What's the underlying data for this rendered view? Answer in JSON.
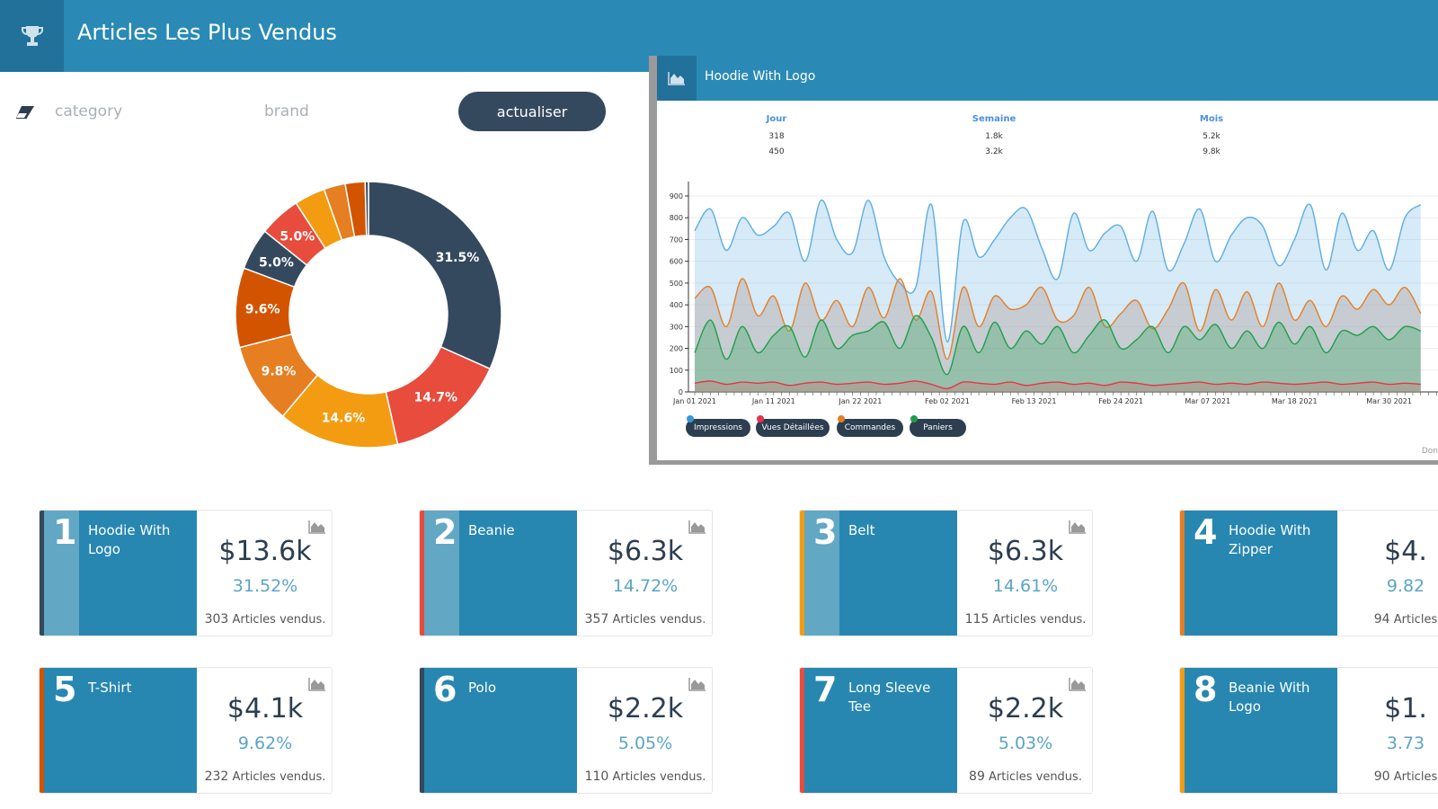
{
  "header": {
    "title": "Articles Les Plus Vendus",
    "icon": "trophy-icon"
  },
  "filters": {
    "category_placeholder": "category",
    "brand_placeholder": "brand",
    "refresh_label": "actualiser",
    "clear_icon": "eraser-icon"
  },
  "colors": {
    "header": "#2a8ab5",
    "navy": "#34495e",
    "red": "#e74c3c",
    "yellow": "#f39c12",
    "orange": "#e67e22",
    "darkorange": "#d35400"
  },
  "donut": {
    "type": "pie",
    "segments": [
      {
        "value": 31.52,
        "label": "31.5%",
        "color": "#34495e"
      },
      {
        "value": 14.72,
        "label": "14.7%",
        "color": "#e74c3c"
      },
      {
        "value": 14.61,
        "label": "14.6%",
        "color": "#f39c12"
      },
      {
        "value": 9.82,
        "label": "9.8%",
        "color": "#e67e22"
      },
      {
        "value": 9.62,
        "label": "9.6%",
        "color": "#d35400"
      },
      {
        "value": 5.05,
        "label": "5.0%",
        "color": "#34495e"
      },
      {
        "value": 5.03,
        "label": "5.0%",
        "color": "#e74c3c"
      },
      {
        "value": 3.73,
        "label": "",
        "color": "#f39c12"
      },
      {
        "value": 2.6,
        "label": "",
        "color": "#e67e22"
      },
      {
        "value": 2.4,
        "label": "",
        "color": "#d35400"
      },
      {
        "value": 0.4,
        "label": "",
        "color": "#34495e"
      }
    ]
  },
  "panel": {
    "title": "Hoodie With Logo",
    "icon": "area-chart-icon",
    "stats": [
      {
        "head": "Jour",
        "v1": "318",
        "v2": "450"
      },
      {
        "head": "Semaine",
        "v1": "1.8k",
        "v2": "3.2k"
      },
      {
        "head": "Mois",
        "v1": "5.2k",
        "v2": "9.8k"
      }
    ],
    "footer": "Don"
  },
  "chart_data": {
    "type": "area",
    "ylim": [
      0,
      900
    ],
    "yticks": [
      0,
      100,
      200,
      300,
      400,
      500,
      600,
      700,
      800,
      900
    ],
    "xticks": [
      "Jan 01 2021",
      "Jan 11 2021",
      "Jan 22 2021",
      "Feb 02 2021",
      "Feb 13 2021",
      "Feb 24 2021",
      "Mar 07 2021",
      "Mar 18 2021",
      "Mar 30 2021"
    ],
    "x_start": "2021-01-01",
    "x_step_days": 2,
    "series": [
      {
        "name": "Impressions",
        "color": "#5dade2",
        "values": [
          740,
          840,
          650,
          800,
          720,
          760,
          820,
          600,
          880,
          700,
          640,
          880,
          620,
          500,
          480,
          860,
          230,
          780,
          620,
          700,
          800,
          840,
          660,
          520,
          820,
          650,
          730,
          760,
          600,
          830,
          560,
          680,
          840,
          600,
          720,
          800,
          760,
          580,
          700,
          860,
          560,
          820,
          650,
          740,
          560,
          800,
          860
        ]
      },
      {
        "name": "Vues Détaillées",
        "color": "#e8334a",
        "values": [
          40,
          50,
          35,
          45,
          40,
          45,
          30,
          40,
          45,
          35,
          40,
          45,
          35,
          40,
          50,
          35,
          15,
          45,
          40,
          35,
          45,
          30,
          40,
          45,
          35,
          40,
          30,
          45,
          40,
          30,
          35,
          40,
          45,
          35,
          40,
          35,
          45,
          40,
          35,
          40,
          45,
          35,
          40,
          45,
          35,
          40,
          35
        ]
      },
      {
        "name": "Commandes",
        "color": "#e67e22",
        "values": [
          430,
          480,
          300,
          520,
          350,
          440,
          280,
          500,
          330,
          420,
          300,
          480,
          340,
          520,
          330,
          460,
          150,
          480,
          300,
          440,
          380,
          400,
          480,
          330,
          350,
          480,
          300,
          360,
          420,
          290,
          380,
          500,
          280,
          470,
          330,
          460,
          300,
          500,
          330,
          420,
          300,
          440,
          380,
          470,
          400,
          480,
          360
        ]
      },
      {
        "name": "Paniers",
        "color": "#1e9e4a",
        "values": [
          180,
          330,
          150,
          300,
          180,
          260,
          300,
          160,
          330,
          200,
          260,
          280,
          320,
          200,
          350,
          250,
          80,
          300,
          180,
          320,
          200,
          280,
          220,
          300,
          180,
          260,
          330,
          200,
          240,
          300,
          180,
          300,
          240,
          310,
          200,
          280,
          200,
          320,
          220,
          300,
          180,
          280,
          260,
          300,
          240,
          300,
          280
        ]
      }
    ]
  },
  "cards": [
    {
      "rank": "1",
      "name": "Hoodie With Logo",
      "amount": "$13.6k",
      "pct": "31.52%",
      "sold": "303",
      "sold_label": "Articles vendus.",
      "color": "#34495e",
      "top": true
    },
    {
      "rank": "2",
      "name": "Beanie",
      "amount": "$6.3k",
      "pct": "14.72%",
      "sold": "357",
      "sold_label": "Articles vendus.",
      "color": "#e74c3c",
      "top": true
    },
    {
      "rank": "3",
      "name": "Belt",
      "amount": "$6.3k",
      "pct": "14.61%",
      "sold": "115",
      "sold_label": "Articles vendus.",
      "color": "#f39c12",
      "top": true
    },
    {
      "rank": "4",
      "name": "Hoodie With Zipper",
      "amount": "$4.",
      "pct": "9.82",
      "sold": "94",
      "sold_label": "Articles",
      "color": "#e67e22",
      "top": false
    },
    {
      "rank": "5",
      "name": "T-Shirt",
      "amount": "$4.1k",
      "pct": "9.62%",
      "sold": "232",
      "sold_label": "Articles vendus.",
      "color": "#d35400",
      "top": false
    },
    {
      "rank": "6",
      "name": "Polo",
      "amount": "$2.2k",
      "pct": "5.05%",
      "sold": "110",
      "sold_label": "Articles vendus.",
      "color": "#34495e",
      "top": false
    },
    {
      "rank": "7",
      "name": "Long Sleeve Tee",
      "amount": "$2.2k",
      "pct": "5.03%",
      "sold": "89",
      "sold_label": "Articles vendus.",
      "color": "#e74c3c",
      "top": false
    },
    {
      "rank": "8",
      "name": "Beanie With Logo",
      "amount": "$1.",
      "pct": "3.73",
      "sold": "90",
      "sold_label": "Articles",
      "color": "#f39c12",
      "top": false
    }
  ]
}
